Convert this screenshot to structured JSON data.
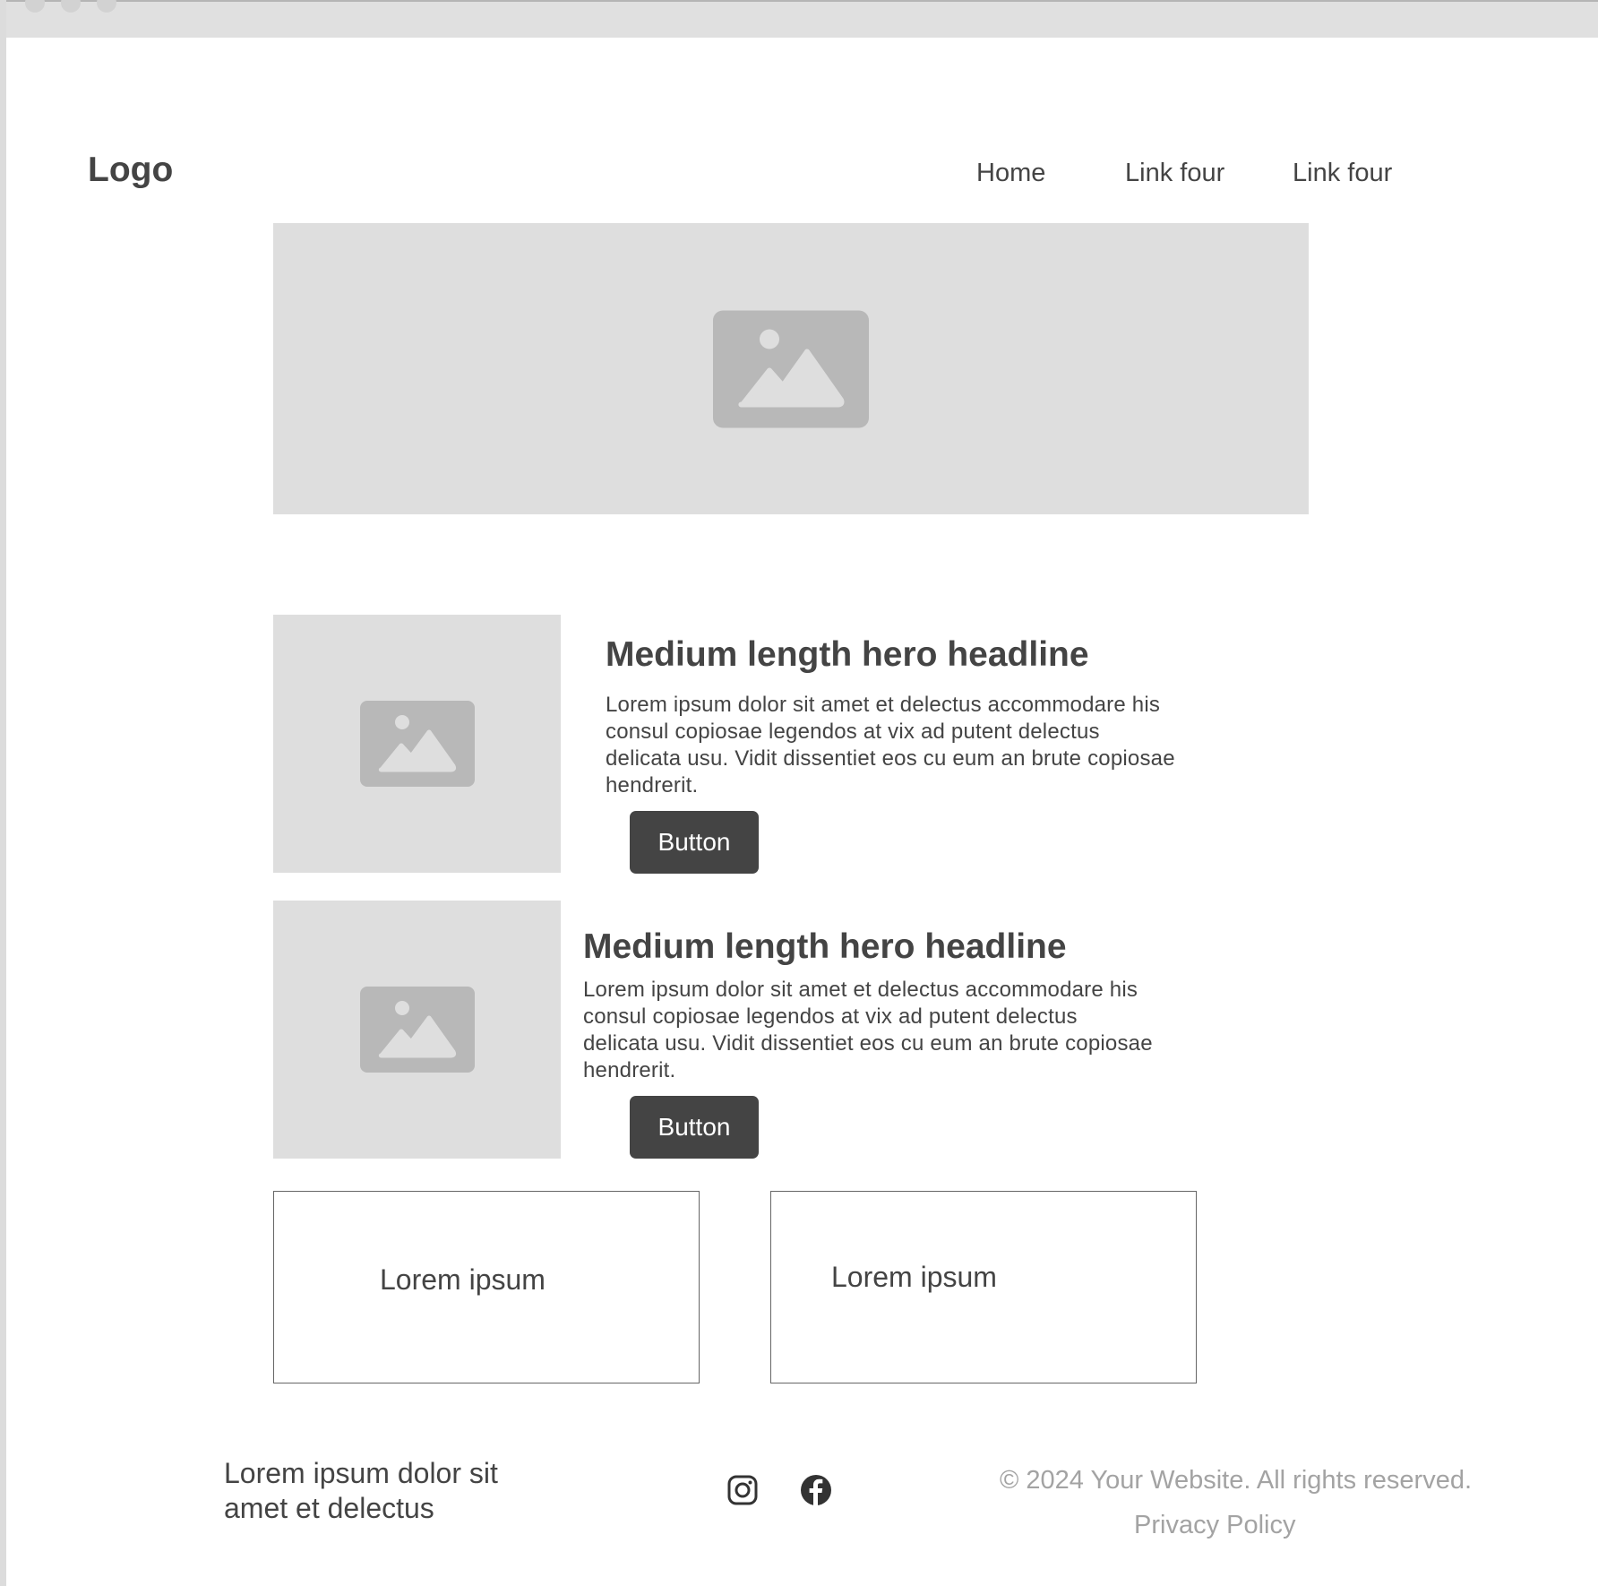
{
  "header": {
    "logo": "Logo",
    "nav": [
      "Home",
      "Link four",
      "Link four"
    ]
  },
  "hero": {
    "image_icon": "image-icon"
  },
  "features": [
    {
      "headline": "Medium length hero headline",
      "body": "Lorem ipsum dolor sit amet et delectus accommodare his consul copiosae legendos at vix ad putent delectus delicata usu. Vidit dissentiet eos cu eum an brute copiosae hendrerit.",
      "button": "Button",
      "image_icon": "image-icon"
    },
    {
      "headline": "Medium length hero headline",
      "body": "Lorem ipsum dolor sit amet et delectus accommodare his consul copiosae legendos at vix ad putent delectus delicata usu. Vidit dissentiet eos cu eum an brute copiosae hendrerit.",
      "button": "Button",
      "image_icon": "image-icon"
    }
  ],
  "boxes": [
    {
      "label": "Lorem ipsum"
    },
    {
      "label": "Lorem ipsum"
    }
  ],
  "footer": {
    "text": "Lorem ipsum dolor sit amet et delectus",
    "social_icons": [
      "instagram-icon",
      "facebook-icon"
    ],
    "copyright": "© 2024 Your Website. All rights reserved.",
    "privacy": "Privacy Policy"
  },
  "colors": {
    "text": "#444444",
    "placeholder": "#dedede",
    "placeholder_icon": "#b8b8b8",
    "button": "#444444",
    "muted": "#a3a3a3"
  }
}
